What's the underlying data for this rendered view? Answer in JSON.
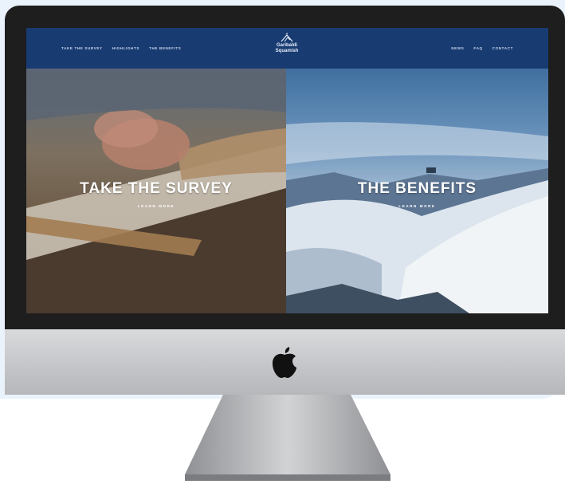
{
  "header": {
    "nav_left": [
      "TAKE THE SURVEY",
      "HIGHLIGHTS",
      "THE BENEFITS"
    ],
    "brand_line1": "Garibaldi",
    "brand_line2": "Squamish",
    "nav_right": [
      "NEWS",
      "FAQ",
      "CONTACT"
    ]
  },
  "panels": {
    "survey": {
      "title": "TAKE THE SURVEY",
      "link": "LEARN MORE"
    },
    "benefits": {
      "title": "THE BENEFITS",
      "link": "LEARN MORE"
    }
  },
  "icons": {
    "brand_mark": "mountain-icon",
    "monitor_logo": "apple-logo-icon"
  },
  "colors": {
    "header_bg": "#183b72",
    "bezel": "#1e1e1f",
    "chin": "#c4c6c9"
  }
}
